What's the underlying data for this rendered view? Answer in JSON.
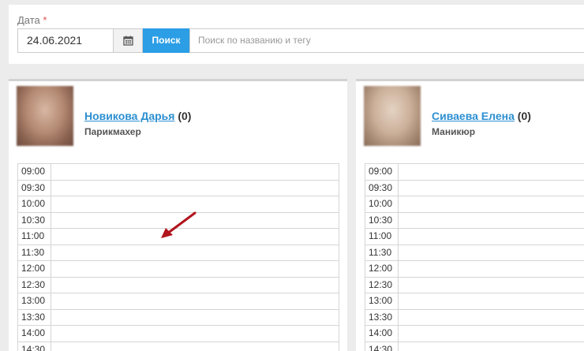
{
  "filter": {
    "date_label": "Дата",
    "required_mark": "*",
    "date_value": "24.06.2021",
    "calendar_icon": "calendar-icon",
    "search_button": "Поиск",
    "search_placeholder": "Поиск по названию и тегу"
  },
  "staff": [
    {
      "name": "Новикова Дарья",
      "count": "(0)",
      "role": "Парикмахер",
      "slots": [
        "09:00",
        "09:30",
        "10:00",
        "10:30",
        "11:00",
        "11:30",
        "12:00",
        "12:30",
        "13:00",
        "13:30",
        "14:00",
        "14:30"
      ]
    },
    {
      "name": "Сиваева Елена",
      "count": "(0)",
      "role": "Маникюр",
      "slots": [
        "09:00",
        "09:30",
        "10:00",
        "10:30",
        "11:00",
        "11:30",
        "12:00",
        "12:30",
        "13:00",
        "13:30",
        "14:00",
        "14:30"
      ]
    }
  ],
  "colors": {
    "accent": "#2b9ee6",
    "link": "#2c8fd1",
    "arrow": "#b0141c"
  }
}
